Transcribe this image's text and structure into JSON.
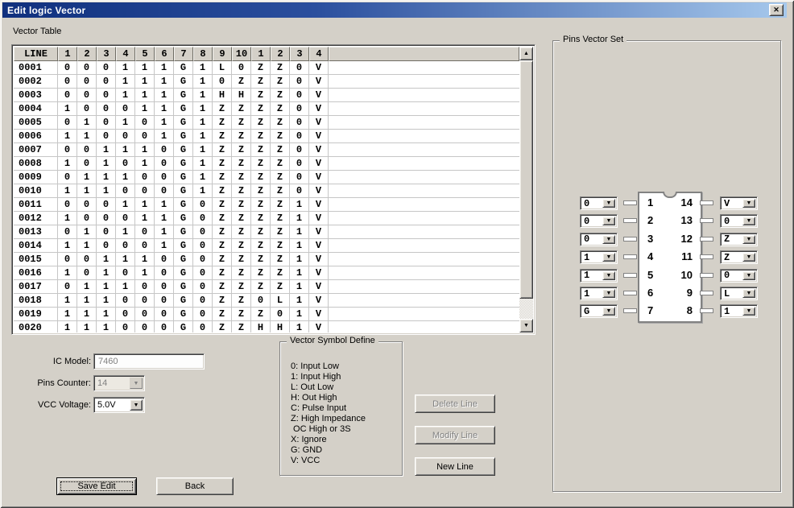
{
  "window": {
    "title": "Edit logic Vector"
  },
  "icons": {
    "close": "✕",
    "up_arrow": "▲",
    "down_arrow": "▼",
    "dropdown": "▼"
  },
  "colors": {
    "titlebar_start": "#10307e",
    "titlebar_end": "#a6c8ec",
    "dialog_bg": "#d4d0c8",
    "grid_line": "#c6c6c6",
    "disabled_text": "#808080"
  },
  "vector_table": {
    "label": "Vector Table",
    "headers": [
      "LINE",
      "1",
      "2",
      "3",
      "4",
      "5",
      "6",
      "7",
      "8",
      "9",
      "10",
      "1",
      "2",
      "3",
      "4"
    ],
    "rows": [
      {
        "line": "0001",
        "values": [
          "0",
          "0",
          "0",
          "1",
          "1",
          "1",
          "G",
          "1",
          "L",
          "0",
          "Z",
          "Z",
          "0",
          "V"
        ]
      },
      {
        "line": "0002",
        "values": [
          "0",
          "0",
          "0",
          "1",
          "1",
          "1",
          "G",
          "1",
          "0",
          "Z",
          "Z",
          "Z",
          "0",
          "V"
        ]
      },
      {
        "line": "0003",
        "values": [
          "0",
          "0",
          "0",
          "1",
          "1",
          "1",
          "G",
          "1",
          "H",
          "H",
          "Z",
          "Z",
          "0",
          "V"
        ]
      },
      {
        "line": "0004",
        "values": [
          "1",
          "0",
          "0",
          "0",
          "1",
          "1",
          "G",
          "1",
          "Z",
          "Z",
          "Z",
          "Z",
          "0",
          "V"
        ]
      },
      {
        "line": "0005",
        "values": [
          "0",
          "1",
          "0",
          "1",
          "0",
          "1",
          "G",
          "1",
          "Z",
          "Z",
          "Z",
          "Z",
          "0",
          "V"
        ]
      },
      {
        "line": "0006",
        "values": [
          "1",
          "1",
          "0",
          "0",
          "0",
          "1",
          "G",
          "1",
          "Z",
          "Z",
          "Z",
          "Z",
          "0",
          "V"
        ]
      },
      {
        "line": "0007",
        "values": [
          "0",
          "0",
          "1",
          "1",
          "1",
          "0",
          "G",
          "1",
          "Z",
          "Z",
          "Z",
          "Z",
          "0",
          "V"
        ]
      },
      {
        "line": "0008",
        "values": [
          "1",
          "0",
          "1",
          "0",
          "1",
          "0",
          "G",
          "1",
          "Z",
          "Z",
          "Z",
          "Z",
          "0",
          "V"
        ]
      },
      {
        "line": "0009",
        "values": [
          "0",
          "1",
          "1",
          "1",
          "0",
          "0",
          "G",
          "1",
          "Z",
          "Z",
          "Z",
          "Z",
          "0",
          "V"
        ]
      },
      {
        "line": "0010",
        "values": [
          "1",
          "1",
          "1",
          "0",
          "0",
          "0",
          "G",
          "1",
          "Z",
          "Z",
          "Z",
          "Z",
          "0",
          "V"
        ]
      },
      {
        "line": "0011",
        "values": [
          "0",
          "0",
          "0",
          "1",
          "1",
          "1",
          "G",
          "0",
          "Z",
          "Z",
          "Z",
          "Z",
          "1",
          "V"
        ]
      },
      {
        "line": "0012",
        "values": [
          "1",
          "0",
          "0",
          "0",
          "1",
          "1",
          "G",
          "0",
          "Z",
          "Z",
          "Z",
          "Z",
          "1",
          "V"
        ]
      },
      {
        "line": "0013",
        "values": [
          "0",
          "1",
          "0",
          "1",
          "0",
          "1",
          "G",
          "0",
          "Z",
          "Z",
          "Z",
          "Z",
          "1",
          "V"
        ]
      },
      {
        "line": "0014",
        "values": [
          "1",
          "1",
          "0",
          "0",
          "0",
          "1",
          "G",
          "0",
          "Z",
          "Z",
          "Z",
          "Z",
          "1",
          "V"
        ]
      },
      {
        "line": "0015",
        "values": [
          "0",
          "0",
          "1",
          "1",
          "1",
          "0",
          "G",
          "0",
          "Z",
          "Z",
          "Z",
          "Z",
          "1",
          "V"
        ]
      },
      {
        "line": "0016",
        "values": [
          "1",
          "0",
          "1",
          "0",
          "1",
          "0",
          "G",
          "0",
          "Z",
          "Z",
          "Z",
          "Z",
          "1",
          "V"
        ]
      },
      {
        "line": "0017",
        "values": [
          "0",
          "1",
          "1",
          "1",
          "0",
          "0",
          "G",
          "0",
          "Z",
          "Z",
          "Z",
          "Z",
          "1",
          "V"
        ]
      },
      {
        "line": "0018",
        "values": [
          "1",
          "1",
          "1",
          "0",
          "0",
          "0",
          "G",
          "0",
          "Z",
          "Z",
          "0",
          "L",
          "1",
          "V"
        ]
      },
      {
        "line": "0019",
        "values": [
          "1",
          "1",
          "1",
          "0",
          "0",
          "0",
          "G",
          "0",
          "Z",
          "Z",
          "Z",
          "0",
          "1",
          "V"
        ]
      },
      {
        "line": "0020",
        "values": [
          "1",
          "1",
          "1",
          "0",
          "0",
          "0",
          "G",
          "0",
          "Z",
          "Z",
          "H",
          "H",
          "1",
          "V"
        ]
      }
    ]
  },
  "settings": {
    "ic_model_label": "IC Model:",
    "ic_model_value": "7460",
    "pins_counter_label": "Pins Counter:",
    "pins_counter_value": "14",
    "vcc_label": "VCC Voltage:",
    "vcc_value": "5.0V"
  },
  "symbol_define": {
    "title": "Vector Symbol Define",
    "lines": [
      "0: Input Low",
      "1: Input High",
      "L: Out Low",
      "H: Out High",
      "C: Pulse Input",
      "Z: High Impedance",
      " OC High or 3S",
      "X: Ignore",
      "G: GND",
      "V: VCC"
    ]
  },
  "actions": {
    "delete_line": "Delete Line",
    "modify_line": "Modify Line",
    "new_line": "New Line",
    "save_edit": "Save Edit",
    "back": "Back"
  },
  "pins_vector_set": {
    "title": "Pins Vector Set",
    "left_pins": [
      {
        "pin": "1",
        "value": "0"
      },
      {
        "pin": "2",
        "value": "0"
      },
      {
        "pin": "3",
        "value": "0"
      },
      {
        "pin": "4",
        "value": "1"
      },
      {
        "pin": "5",
        "value": "1"
      },
      {
        "pin": "6",
        "value": "1"
      },
      {
        "pin": "7",
        "value": "G"
      }
    ],
    "right_pins": [
      {
        "pin": "14",
        "value": "V"
      },
      {
        "pin": "13",
        "value": "0"
      },
      {
        "pin": "12",
        "value": "Z"
      },
      {
        "pin": "11",
        "value": "Z"
      },
      {
        "pin": "10",
        "value": "0"
      },
      {
        "pin": "9",
        "value": "L"
      },
      {
        "pin": "8",
        "value": "1"
      }
    ]
  }
}
